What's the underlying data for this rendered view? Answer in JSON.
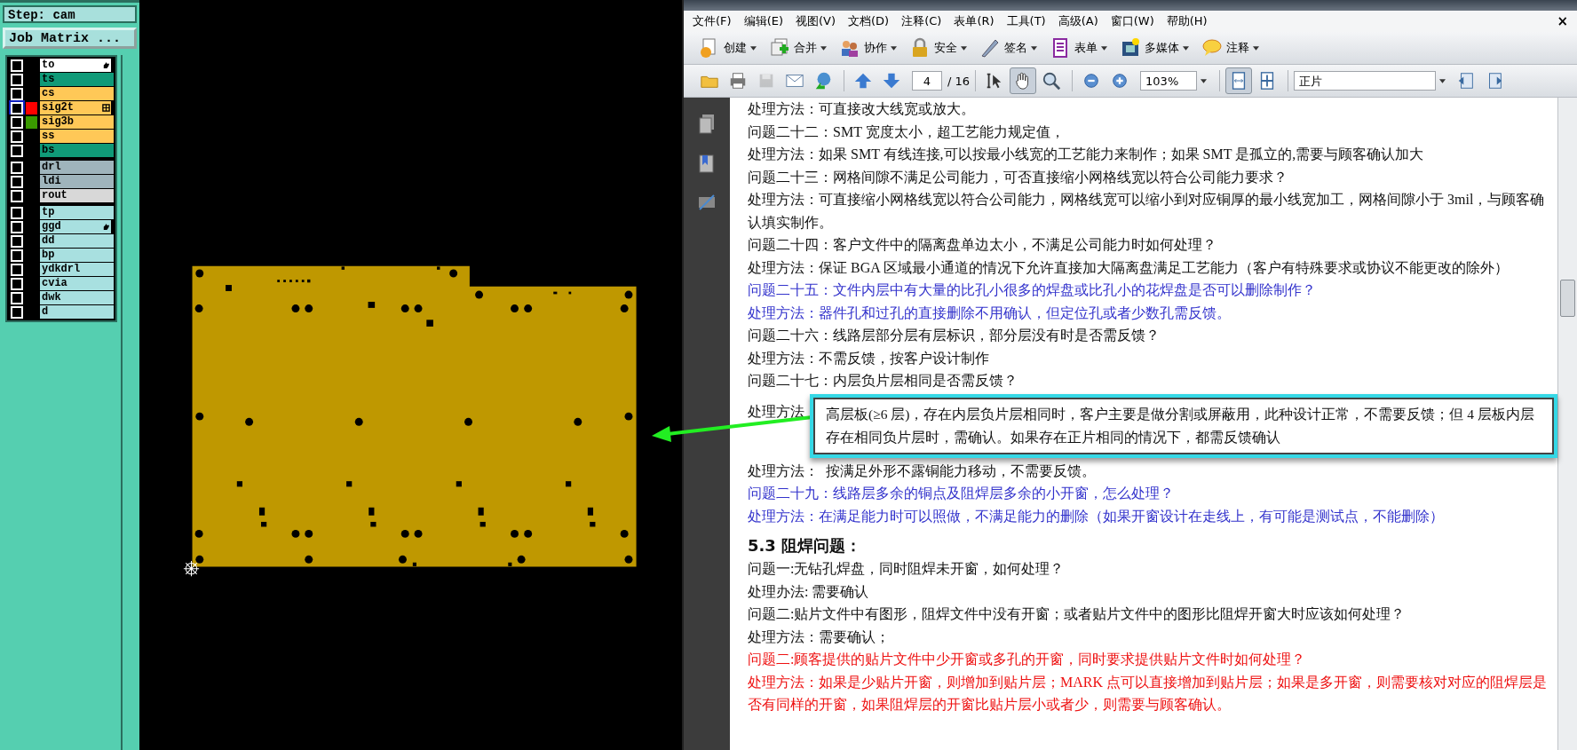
{
  "layer_panel": {
    "step": "Step: cam",
    "job_matrix_button": "Job Matrix ...",
    "groups": [
      [
        {
          "name": "to",
          "color": "#ffffff",
          "hand_mark": true,
          "grid_mark": false,
          "selected": false,
          "checked": false
        },
        {
          "name": "ts",
          "color": "#109a78",
          "selected": false,
          "checked": false
        },
        {
          "name": "cs",
          "color": "#ffc857",
          "selected": false,
          "checked": false
        },
        {
          "name": "sig2t",
          "color": "#ffc857",
          "swatch": {
            "color": "#ff0000"
          },
          "hand_mark": false,
          "grid_mark": true,
          "selected": true,
          "checked": false
        },
        {
          "name": "sig3b",
          "color": "#ffc857",
          "swatch": {
            "color": "#3a9a00"
          },
          "selected": false,
          "checked": false
        },
        {
          "name": "ss",
          "color": "#ffc857",
          "selected": false,
          "checked": false
        },
        {
          "name": "bs",
          "color": "#109a78",
          "selected": false,
          "checked": false
        }
      ],
      [
        {
          "name": "drl",
          "color": "#9fb4bc",
          "selected": false,
          "checked": false
        },
        {
          "name": "ldi",
          "color": "#9fb4bc",
          "selected": false,
          "checked": false
        },
        {
          "name": "rout",
          "color": "#d8d8d8",
          "selected": false,
          "checked": false
        }
      ],
      [
        {
          "name": "tp",
          "color": "#a8e0e0",
          "selected": false,
          "checked": false
        },
        {
          "name": "ggd",
          "color": "#a8e0e0",
          "hand_mark": true,
          "grid_mark": false,
          "selected": false,
          "checked": false
        },
        {
          "name": "dd",
          "color": "#a8e0e0",
          "selected": false,
          "checked": false
        },
        {
          "name": "bp",
          "color": "#a8e0e0",
          "selected": false,
          "checked": false
        },
        {
          "name": "ydkdrl",
          "color": "#a8e0e0",
          "selected": false,
          "checked": false
        },
        {
          "name": "cvia",
          "color": "#a8e0e0",
          "selected": false,
          "checked": false
        },
        {
          "name": "dwk",
          "color": "#a8e0e0",
          "selected": false,
          "checked": false
        },
        {
          "name": "d",
          "color": "#a8e0e0",
          "selected": false,
          "checked": false
        }
      ]
    ]
  },
  "acrobat": {
    "menu": [
      "文件(F)",
      "编辑(E)",
      "视图(V)",
      "文档(D)",
      "注释(C)",
      "表单(R)",
      "工具(T)",
      "高级(A)",
      "窗口(W)",
      "帮助(H)"
    ],
    "close": "×",
    "tools": [
      "创建",
      "合并",
      "协作",
      "安全",
      "签名",
      "表单",
      "多媒体",
      "注释"
    ],
    "nav_tools": [
      {
        "selected": false,
        "disabled": false
      },
      {
        "selected": false,
        "disabled": false
      },
      {
        "selected": false,
        "disabled": true
      },
      {
        "selected": false,
        "disabled": false
      },
      {
        "selected": false,
        "disabled": false
      },
      {
        "selected": false,
        "disabled": false
      },
      {
        "selected": false,
        "disabled": false
      },
      {
        "selected": false,
        "disabled": false
      },
      {
        "selected": true,
        "disabled": false
      },
      {
        "selected": false,
        "disabled": false
      },
      {
        "selected": false,
        "disabled": false
      },
      {
        "selected": false,
        "disabled": false
      },
      {
        "selected": true,
        "disabled": false
      },
      {
        "selected": false,
        "disabled": false
      },
      {
        "selected": false,
        "disabled": false
      },
      {
        "selected": false,
        "disabled": false
      }
    ],
    "page": "4",
    "total": "/ 16",
    "zoom": "103%",
    "view": "正片",
    "lines": [
      {
        "kind": "text",
        "color": "#111111",
        "text": "处理方法：可直接改大线宽或放大。"
      },
      {
        "kind": "text",
        "color": "#111111",
        "text": "问题二十二：SMT 宽度太小，超工艺能力规定值，"
      },
      {
        "kind": "text",
        "color": "#111111",
        "text": "处理方法：如果 SMT 有线连接,可以按最小线宽的工艺能力来制作；如果 SMT 是孤立的,需要与顾客确认加大"
      },
      {
        "kind": "text",
        "color": "#111111",
        "text": "问题二十三：网格间隙不满足公司能力，可否直接缩小网格线宽以符合公司能力要求？"
      },
      {
        "kind": "text",
        "color": "#111111",
        "text": "处理方法：可直接缩小网格线宽以符合公司能力，网格线宽可以缩小到对应铜厚的最小线宽加工，网格间隙小于 3mil，与顾客确认填实制作。"
      },
      {
        "kind": "text",
        "color": "#111111",
        "text": "问题二十四：客户文件中的隔离盘单边太小，不满足公司能力时如何处理？"
      },
      {
        "kind": "text",
        "color": "#111111",
        "text": "处理方法：保证 BGA 区域最小通道的情况下允许直接加大隔离盘满足工艺能力（客户有特殊要求或协议不能更改的除外）"
      },
      {
        "kind": "text",
        "color": "#3333cc",
        "text": "问题二十五：文件内层中有大量的比孔小很多的焊盘或比孔小的花焊盘是否可以删除制作？"
      },
      {
        "kind": "text",
        "color": "#3333cc",
        "text": "处理方法：器件孔和过孔的直接删除不用确认，但定位孔或者少数孔需反馈。"
      },
      {
        "kind": "text",
        "color": "#111111",
        "text": "问题二十六：线路层部分层有层标识，部分层没有时是否需反馈？"
      },
      {
        "kind": "text",
        "color": "#111111",
        "text": "处理方法：不需反馈，按客户设计制作"
      },
      {
        "kind": "text",
        "color": "#111111",
        "text": "问题二十七：内层负片层相同是否需反馈？"
      },
      {
        "kind": "callout",
        "color": "#111111",
        "label": "处理方法",
        "text": "高层板(≥6 层)，存在内层负片层相同时，客户主要是做分割或屏蔽用，此种设计正常，不需要反馈；但 4 层板内层存在相同负片层时，需确认。如果存在正片相同的情况下，都需反馈确认"
      },
      {
        "kind": "text",
        "color": "#111111",
        "text": "处理方法：  按满足外形不露铜能力移动，不需要反馈。"
      },
      {
        "kind": "text",
        "color": "#3333cc",
        "text": "问题二十九：线路层多余的铜点及阻焊层多余的小开窗，怎么处理？"
      },
      {
        "kind": "text",
        "color": "#3333cc",
        "text": "处理方法：在满足能力时可以照做，不满足能力的删除（如果开窗设计在走线上，有可能是测试点，不能删除）"
      },
      {
        "kind": "heading",
        "color": "#111111",
        "text": "5.3 阻焊问题："
      },
      {
        "kind": "text",
        "color": "#111111",
        "text": "问题一:无钻孔焊盘，同时阻焊未开窗，如何处理？"
      },
      {
        "kind": "text",
        "color": "#111111",
        "text": "处理办法: 需要确认"
      },
      {
        "kind": "text",
        "color": "#111111",
        "text": "问题二:贴片文件中有图形，阻焊文件中没有开窗；或者贴片文件中的图形比阻焊开窗大时应该如何处理？"
      },
      {
        "kind": "text",
        "color": "#111111",
        "text": "处理方法：需要确认；"
      },
      {
        "kind": "text",
        "color": "#ee1111",
        "text": "问题二:顾客提供的贴片文件中少开窗或多孔的开窗，同时要求提供贴片文件时如何处理？"
      },
      {
        "kind": "text",
        "color": "#ee1111",
        "text": "处理方法：如果是少贴片开窗，则增加到贴片层；MARK 点可以直接增加到贴片层；如果是多开窗，则需要核对对应的阻焊层是否有同样的开窗，如果阻焊层的开窗比贴片层小或者少，则需要与顾客确认。"
      }
    ]
  }
}
